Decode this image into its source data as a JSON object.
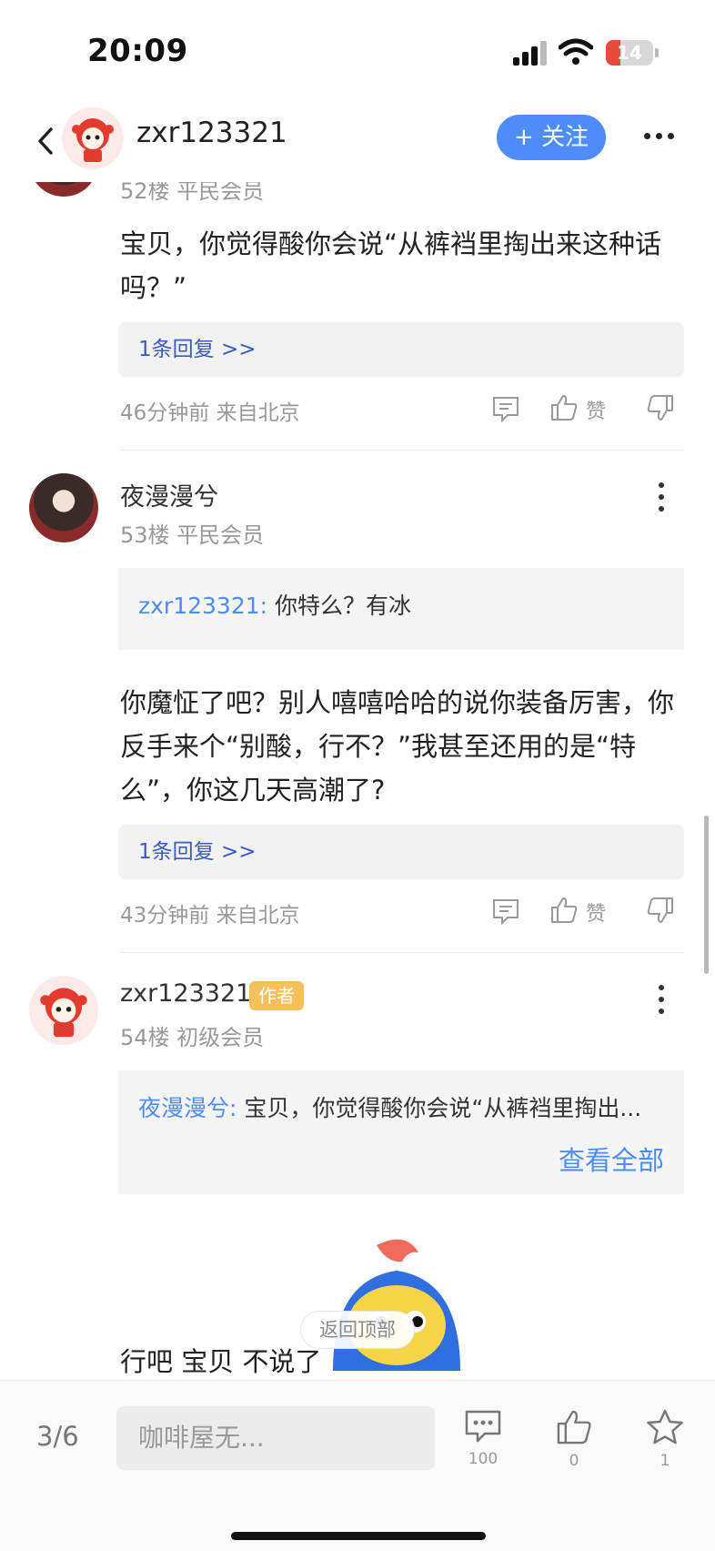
{
  "status_bar": {
    "time": "20:09",
    "battery": "14"
  },
  "header": {
    "username": "zxr123321",
    "follow_label": "+ 关注"
  },
  "posts": [
    {
      "floor": "52楼 平民会员",
      "content": "宝贝，你觉得酸你会说“从裤裆里掏出来这种话吗？”",
      "replies": "1条回复 >>",
      "meta": "46分钟前 来自北京",
      "like_label": "赞"
    },
    {
      "username": "夜漫漫兮",
      "floor": "53楼 平民会员",
      "quote_user": "zxr123321:",
      "quote_text": " 你特么？有冰",
      "content": "你魔怔了吧？别人嘻嘻哈哈的说你装备厉害，你反手来个“别酸，行不？”我甚至还用的是“特么”，你这几天高潮了?",
      "replies": "1条回复 >>",
      "meta": "43分钟前 来自北京",
      "like_label": "赞"
    },
    {
      "username": "zxr123321",
      "badge": "作者",
      "floor": "54楼 初级会员",
      "quote_user": "夜漫漫兮:",
      "quote_text": " 宝贝，你觉得酸你会说“从裤裆里掏出...",
      "view_all": "查看全部",
      "content": "行吧 宝贝 不说了"
    }
  ],
  "back_to_top": "返回顶部",
  "bottom_bar": {
    "page": "3/6",
    "input_placeholder": "咖啡屋无...",
    "comment_count": "100",
    "like_count": "0",
    "star_count": "1"
  },
  "colors": {
    "accent": "#4e8cf7",
    "badge": "#f6c15a",
    "link": "#3a5bbf"
  }
}
